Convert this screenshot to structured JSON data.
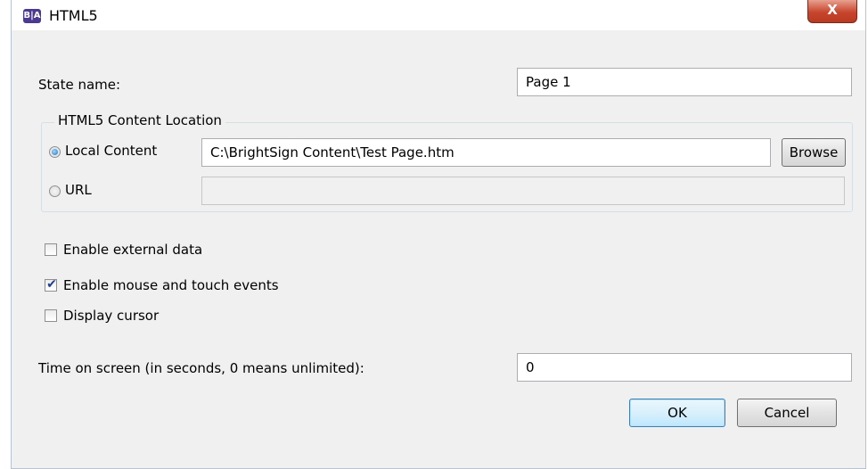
{
  "window": {
    "title": "HTML5",
    "app_icon_text": "B|A",
    "close_glyph": "X"
  },
  "state_name": {
    "label": "State name:",
    "value": "Page 1"
  },
  "content_location": {
    "group_title": "HTML5 Content Location",
    "local_content": {
      "label": "Local Content",
      "selected": true,
      "path": "C:\\BrightSign Content\\Test Page.htm"
    },
    "browse_label": "Browse",
    "url": {
      "label": "URL",
      "selected": false,
      "value": ""
    }
  },
  "options": {
    "enable_external_data": {
      "label": "Enable external data",
      "checked": false
    },
    "enable_mouse_touch": {
      "label": "Enable mouse and touch events",
      "checked": true
    },
    "display_cursor": {
      "label": "Display cursor",
      "checked": false
    }
  },
  "time_on_screen": {
    "label": "Time on screen (in seconds, 0 means unlimited):",
    "value": "0"
  },
  "buttons": {
    "ok_label": "OK",
    "cancel_label": "Cancel"
  },
  "icons": {
    "check_glyph": "✔"
  },
  "colors": {
    "close_button": "#c8452d",
    "app_icon": "#4b3a8f",
    "default_button_border": "#3c7fb1"
  }
}
